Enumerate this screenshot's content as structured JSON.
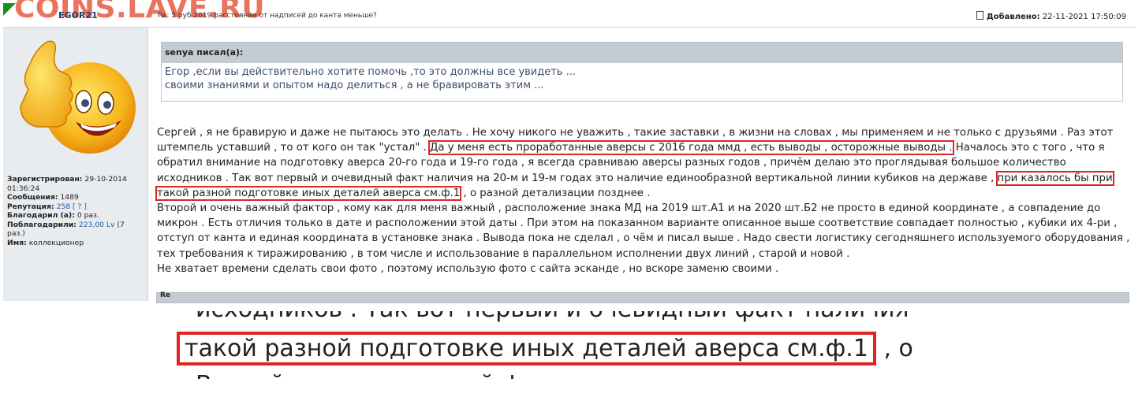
{
  "header": {
    "watermark": "COINS.LAVE.RU",
    "username": "EGOR21",
    "subject": "Re: 5 руб 2019 расстояние от надписей до канта меньше?",
    "added_label": "Добавлено:",
    "added_value": "22-11-2021 17:50:09"
  },
  "user": {
    "registered_label": "Зарегистрирован:",
    "registered_value": "29-10-2014 01:36:24",
    "messages_label": "Сообщения:",
    "messages_value": "1489",
    "reputation_label": "Репутация:",
    "reputation_value": "258",
    "reputation_bracket": "[ ? ]",
    "thanked_label": "Благодарил (а):",
    "thanked_value": "0 раз.",
    "thanked_by_label": "Поблагодарили:",
    "thanked_by_link": "223,00 Lv",
    "thanked_by_rest": "(7 раз.)",
    "name_label": "Имя:",
    "name_value": "коллекционер"
  },
  "quote": {
    "author": "senya писал(а):",
    "line1": "Егор ,если вы действительно хотите помочь ,то это должны все увидеть ...",
    "line2": "своими знаниями и опытом надо делиться , а не бравировать этим ..."
  },
  "post": {
    "l1": "Сергей , я не бравирую и даже не пытаюсь это делать . Не хочу никого не уважить , такие заставки , в жизни на словах , мы применяем и не только с друзьями . Раз этот",
    "l2a": "штемпель уставший , то от кого он так \"устал\" .",
    "l2b": "Да у меня есть проработанные аверсы с 2016 года ммд , есть выводы , осторожные выводы .",
    "l2c": "Началось это с того , что я",
    "l3": "обратил внимание на подготовку аверса 20-го года и 19-го года , я всегда сравниваю аверсы разных годов , причём делаю это проглядывая большое количество",
    "l4a": "исходников . Так вот первый и очевидный факт наличия на 20-м и 19-м годах это наличие единообразной вертикальной линии кубиков на державе ,",
    "l4b": "при казалось бы при",
    "l5a": "такой разной подготовке иных деталей аверса см.ф.1",
    "l5b": ", о разной детализации позднее .",
    "l6": "Второй и очень важный фактор , кому как для меня важный , расположение знака МД на 2019 шт.А1 и на 2020 шт.Б2 не просто в единой координате , а совпадение до",
    "l7": "микрон . Есть отличия только в дате и расположении этой даты . При этом на показанном варианте описанное выше соответствие совпадает полностью , кубики их 4-ри ,",
    "l8": "отступ от канта и единая координата в установке знака . Вывода пока не сделал , о чём и писал выше . Надо свести логистику сегодняшнего используемого оборудования ,",
    "l9": "тех требования к тиражированию , в том числе и использование в параллельном исполнении двух линий , старой и новой .",
    "l10": "Не хватает времени сделать свои фото , поэтому использую фото с сайта эсканде , но вскоре заменю своими ."
  },
  "inset": {
    "top": "исходников . Так вот первый и очевидный факт наличия",
    "highlight": "такой разной подготовке иных деталей аверса см.ф.1",
    "after": ", о",
    "bottom": "Второй и очень важный фактор"
  },
  "next_post_label": "Re"
}
